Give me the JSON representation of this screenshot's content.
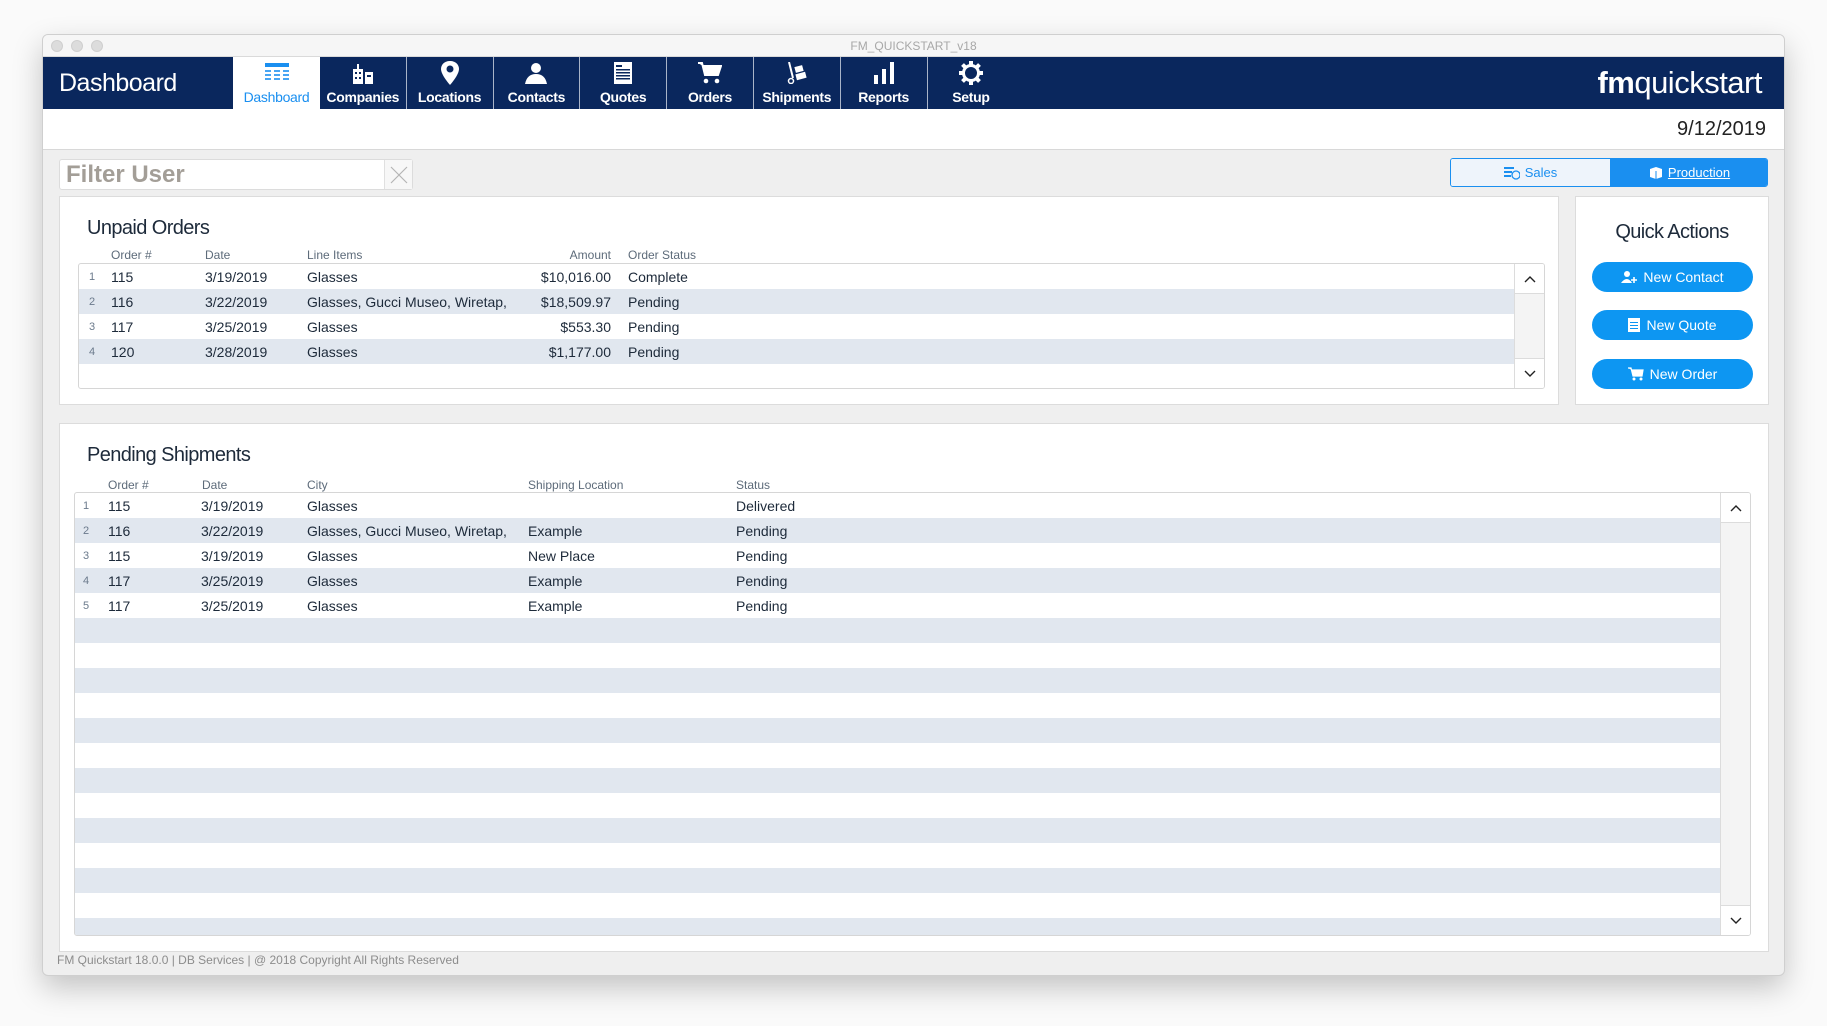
{
  "window": {
    "title": "FM_QUICKSTART_v18"
  },
  "header": {
    "page_title": "Dashboard",
    "brand_bold": "fm",
    "brand_light": "quickstart",
    "date": "9/12/2019"
  },
  "nav": {
    "tabs": [
      {
        "label": "Dashboard",
        "icon": "dashboard-grid-icon",
        "active": true
      },
      {
        "label": "Companies",
        "icon": "buildings-icon",
        "active": false
      },
      {
        "label": "Locations",
        "icon": "map-pin-icon",
        "active": false
      },
      {
        "label": "Contacts",
        "icon": "person-icon",
        "active": false
      },
      {
        "label": "Quotes",
        "icon": "document-icon",
        "active": false
      },
      {
        "label": "Orders",
        "icon": "cart-icon",
        "active": false
      },
      {
        "label": "Shipments",
        "icon": "hand-truck-icon",
        "active": false
      },
      {
        "label": "Reports",
        "icon": "bar-chart-icon",
        "active": false
      },
      {
        "label": "Setup",
        "icon": "gear-icon",
        "active": false
      }
    ]
  },
  "filter": {
    "placeholder": "Filter User",
    "value": ""
  },
  "view_toggle": {
    "options": [
      {
        "label": "Sales",
        "icon": "sales-icon",
        "selected": false
      },
      {
        "label": "Production",
        "icon": "box-icon",
        "selected": true
      }
    ]
  },
  "unpaid_orders": {
    "title": "Unpaid Orders",
    "columns": [
      "Order #",
      "Date",
      "Line Items",
      "Amount",
      "Order Status"
    ],
    "rows": [
      {
        "n": "1",
        "order": "115",
        "date": "3/19/2019",
        "items": "Glasses",
        "amount": "$10,016.00",
        "status": "Complete"
      },
      {
        "n": "2",
        "order": "116",
        "date": "3/22/2019",
        "items": "Glasses, Gucci Museo, Wiretap,",
        "amount": "$18,509.97",
        "status": "Pending"
      },
      {
        "n": "3",
        "order": "117",
        "date": "3/25/2019",
        "items": "Glasses",
        "amount": "$553.30",
        "status": "Pending"
      },
      {
        "n": "4",
        "order": "120",
        "date": "3/28/2019",
        "items": "Glasses",
        "amount": "$1,177.00",
        "status": "Pending"
      }
    ]
  },
  "quick_actions": {
    "title": "Quick Actions",
    "buttons": [
      {
        "label": "New Contact",
        "icon": "add-contact-icon"
      },
      {
        "label": "New Quote",
        "icon": "quote-icon"
      },
      {
        "label": "New Order",
        "icon": "cart-icon"
      }
    ]
  },
  "pending_shipments": {
    "title": "Pending Shipments",
    "columns": [
      "Order #",
      "Date",
      "City",
      "Shipping Location",
      "Status"
    ],
    "rows": [
      {
        "n": "1",
        "order": "115",
        "date": "3/19/2019",
        "city": "Glasses",
        "location": "",
        "status": "Delivered"
      },
      {
        "n": "2",
        "order": "116",
        "date": "3/22/2019",
        "city": "Glasses, Gucci Museo, Wiretap,",
        "location": "Example",
        "status": "Pending"
      },
      {
        "n": "3",
        "order": "115",
        "date": "3/19/2019",
        "city": "Glasses",
        "location": "New Place",
        "status": "Pending"
      },
      {
        "n": "4",
        "order": "117",
        "date": "3/25/2019",
        "city": "Glasses",
        "location": "Example",
        "status": "Pending"
      },
      {
        "n": "5",
        "order": "117",
        "date": "3/25/2019",
        "city": "Glasses",
        "location": "Example",
        "status": "Pending"
      }
    ]
  },
  "footer": {
    "text": "FM Quickstart 18.0.0  | DB Services | @ 2018 Copyright All Rights Reserved"
  },
  "colors": {
    "navy": "#0a275d",
    "accent": "#1a8ff0",
    "row_alt": "#e1e7ef"
  }
}
